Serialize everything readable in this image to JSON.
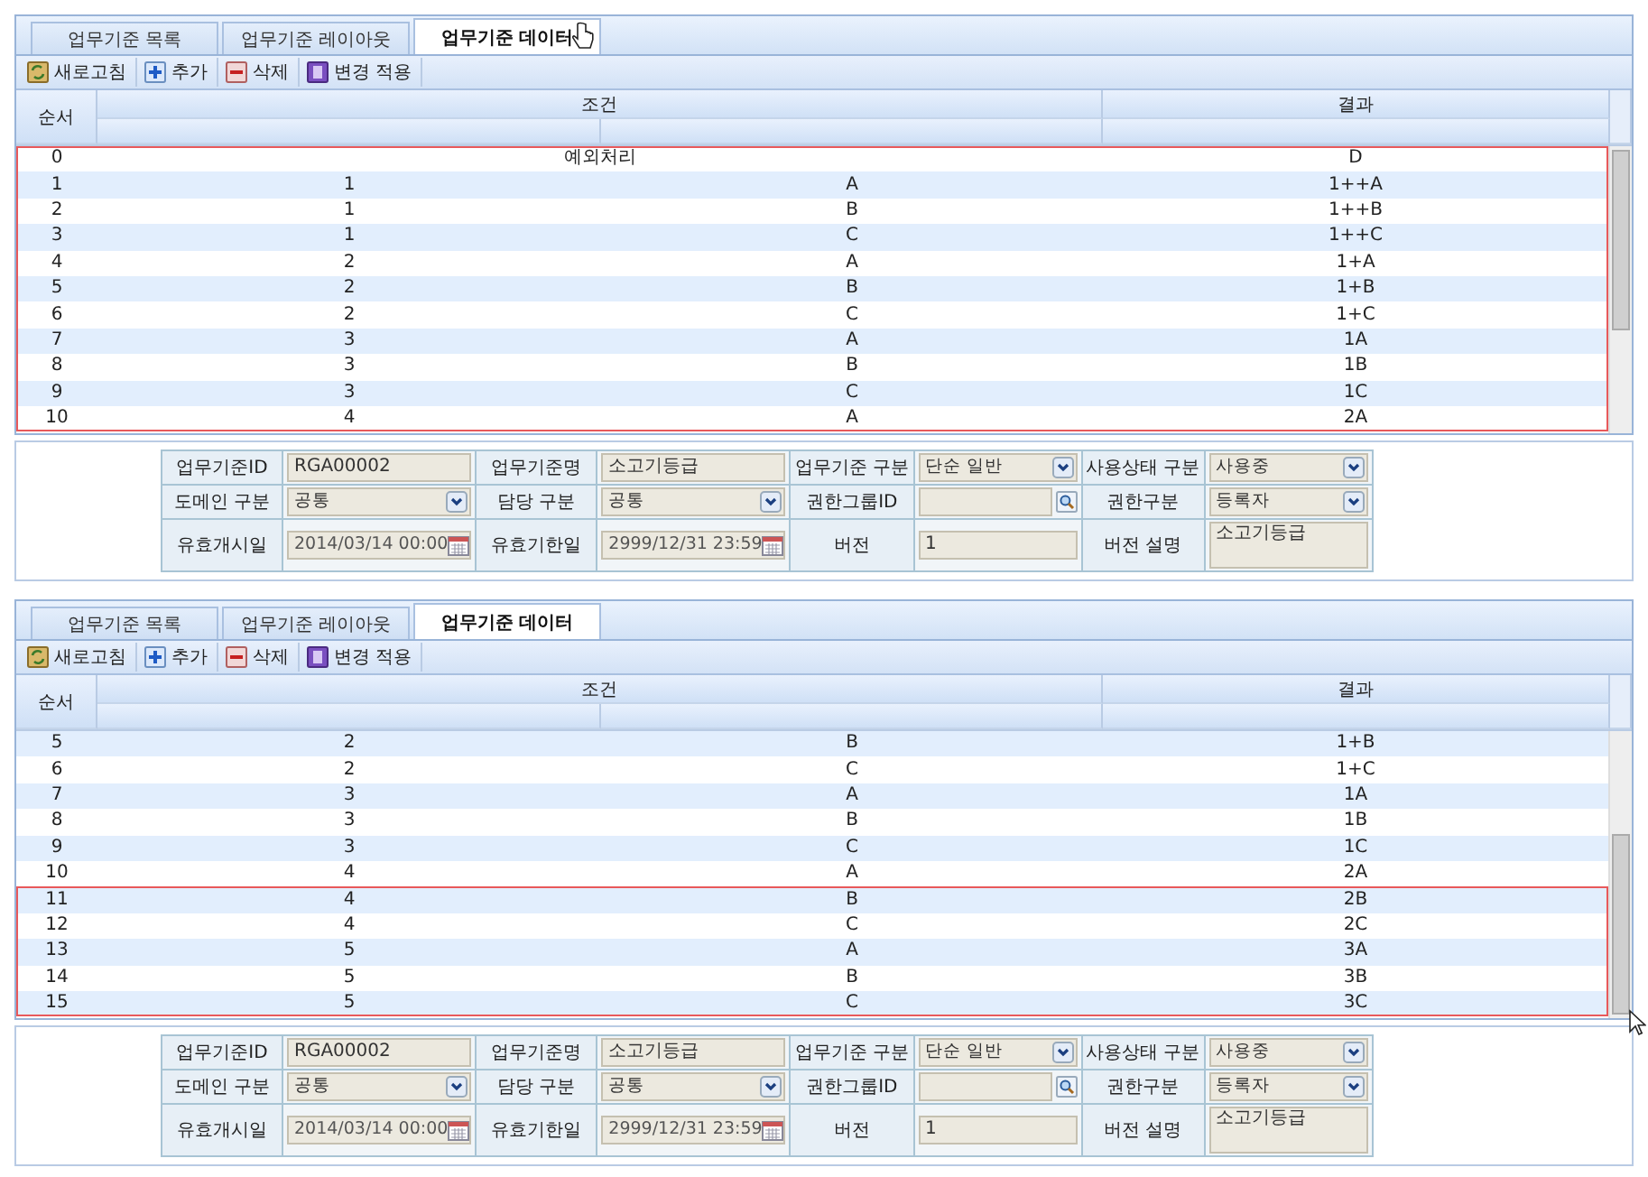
{
  "panels": [
    {
      "tabs": [
        {
          "label": "업무기준 목록",
          "selected": false
        },
        {
          "label": "업무기준 레이아웃",
          "selected": false
        },
        {
          "label": "업무기준 데이터",
          "selected": true
        }
      ],
      "toolbar": [
        {
          "kind": "refresh",
          "label": "새로고침"
        },
        {
          "kind": "add",
          "label": "추가"
        },
        {
          "kind": "delete",
          "label": "삭제"
        },
        {
          "kind": "apply",
          "label": "변경 적용"
        }
      ],
      "grid": {
        "columns": {
          "order": "순서",
          "condition": "조건",
          "result": "결과"
        },
        "rows": [
          {
            "kind": "merged",
            "no": "0",
            "condition": "예외처리",
            "result": "D",
            "highlighted": true
          },
          {
            "kind": "normal",
            "no": "1",
            "cond_1": "1",
            "cond_2": "A",
            "result": "1++A",
            "highlighted": true
          },
          {
            "kind": "normal",
            "no": "2",
            "cond_1": "1",
            "cond_2": "B",
            "result": "1++B",
            "highlighted": true
          },
          {
            "kind": "normal",
            "no": "3",
            "cond_1": "1",
            "cond_2": "C",
            "result": "1++C",
            "highlighted": true
          },
          {
            "kind": "normal",
            "no": "4",
            "cond_1": "2",
            "cond_2": "A",
            "result": "1+A",
            "highlighted": true
          },
          {
            "kind": "normal",
            "no": "5",
            "cond_1": "2",
            "cond_2": "B",
            "result": "1+B",
            "highlighted": true
          },
          {
            "kind": "normal",
            "no": "6",
            "cond_1": "2",
            "cond_2": "C",
            "result": "1+C",
            "highlighted": true
          },
          {
            "kind": "normal",
            "no": "7",
            "cond_1": "3",
            "cond_2": "A",
            "result": "1A",
            "highlighted": true
          },
          {
            "kind": "normal",
            "no": "8",
            "cond_1": "3",
            "cond_2": "B",
            "result": "1B",
            "highlighted": true
          },
          {
            "kind": "normal",
            "no": "9",
            "cond_1": "3",
            "cond_2": "C",
            "result": "1C",
            "highlighted": true
          },
          {
            "kind": "normal",
            "no": "10",
            "cond_1": "4",
            "cond_2": "A",
            "result": "2A",
            "highlighted": true
          }
        ]
      },
      "form": [
        [
          {
            "label": "업무기준ID",
            "kind": "text",
            "value": "RGA00002"
          },
          {
            "label": "업무기준명",
            "kind": "text",
            "value": "소고기등급"
          },
          {
            "label": "업무기준 구분",
            "kind": "select",
            "value": "단순 일반"
          },
          {
            "label": "사용상태 구분",
            "kind": "select",
            "value": "사용중"
          }
        ],
        [
          {
            "label": "도메인 구분",
            "kind": "select",
            "value": "공통"
          },
          {
            "label": "담당 구분",
            "kind": "select",
            "value": "공통"
          },
          {
            "label": "권한그룹ID",
            "kind": "lookup"
          },
          {
            "label": "권한구분",
            "kind": "select",
            "value": "등록자"
          }
        ],
        [
          {
            "label": "유효개시일",
            "kind": "date",
            "value": "2014/03/14 00:00"
          },
          {
            "label": "유효기한일",
            "kind": "date",
            "value": "2999/12/31 23:59"
          },
          {
            "label": "버전",
            "kind": "text",
            "value": "1"
          },
          {
            "label": "버전 설명",
            "kind": "textarea",
            "value": "소고기등급"
          }
        ]
      ]
    },
    {
      "tabs": [
        {
          "label": "업무기준 목록",
          "selected": false
        },
        {
          "label": "업무기준 레이아웃",
          "selected": false
        },
        {
          "label": "업무기준 데이터",
          "selected": true
        }
      ],
      "toolbar": [
        {
          "kind": "refresh",
          "label": "새로고침"
        },
        {
          "kind": "add",
          "label": "추가"
        },
        {
          "kind": "delete",
          "label": "삭제"
        },
        {
          "kind": "apply",
          "label": "변경 적용"
        }
      ],
      "grid": {
        "columns": {
          "order": "순서",
          "condition": "조건",
          "result": "결과"
        },
        "rows": [
          {
            "kind": "normal",
            "no": "5",
            "cond_1": "2",
            "cond_2": "B",
            "result": "1+B",
            "highlighted": false
          },
          {
            "kind": "normal",
            "no": "6",
            "cond_1": "2",
            "cond_2": "C",
            "result": "1+C",
            "highlighted": false
          },
          {
            "kind": "normal",
            "no": "7",
            "cond_1": "3",
            "cond_2": "A",
            "result": "1A",
            "highlighted": false
          },
          {
            "kind": "normal",
            "no": "8",
            "cond_1": "3",
            "cond_2": "B",
            "result": "1B",
            "highlighted": false
          },
          {
            "kind": "normal",
            "no": "9",
            "cond_1": "3",
            "cond_2": "C",
            "result": "1C",
            "highlighted": false
          },
          {
            "kind": "normal",
            "no": "10",
            "cond_1": "4",
            "cond_2": "A",
            "result": "2A",
            "highlighted": false
          },
          {
            "kind": "normal",
            "no": "11",
            "cond_1": "4",
            "cond_2": "B",
            "result": "2B",
            "highlighted": true
          },
          {
            "kind": "normal",
            "no": "12",
            "cond_1": "4",
            "cond_2": "C",
            "result": "2C",
            "highlighted": true
          },
          {
            "kind": "normal",
            "no": "13",
            "cond_1": "5",
            "cond_2": "A",
            "result": "3A",
            "highlighted": true
          },
          {
            "kind": "normal",
            "no": "14",
            "cond_1": "5",
            "cond_2": "B",
            "result": "3B",
            "highlighted": true
          },
          {
            "kind": "normal",
            "no": "15",
            "cond_1": "5",
            "cond_2": "C",
            "result": "3C",
            "highlighted": true
          }
        ]
      },
      "form": [
        [
          {
            "label": "업무기준ID",
            "kind": "text",
            "value": "RGA00002"
          },
          {
            "label": "업무기준명",
            "kind": "text",
            "value": "소고기등급"
          },
          {
            "label": "업무기준 구분",
            "kind": "select",
            "value": "단순 일반"
          },
          {
            "label": "사용상태 구분",
            "kind": "select",
            "value": "사용중"
          }
        ],
        [
          {
            "label": "도메인 구분",
            "kind": "select",
            "value": "공통"
          },
          {
            "label": "담당 구분",
            "kind": "select",
            "value": "공통"
          },
          {
            "label": "권한그룹ID",
            "kind": "lookup"
          },
          {
            "label": "권한구분",
            "kind": "select",
            "value": "등록자"
          }
        ],
        [
          {
            "label": "유효개시일",
            "kind": "date",
            "value": "2014/03/14 00:00"
          },
          {
            "label": "유효기한일",
            "kind": "date",
            "value": "2999/12/31 23:59"
          },
          {
            "label": "버전",
            "kind": "text",
            "value": "1"
          },
          {
            "label": "버전 설명",
            "kind": "textarea",
            "value": "소고기등급"
          }
        ]
      ]
    }
  ]
}
